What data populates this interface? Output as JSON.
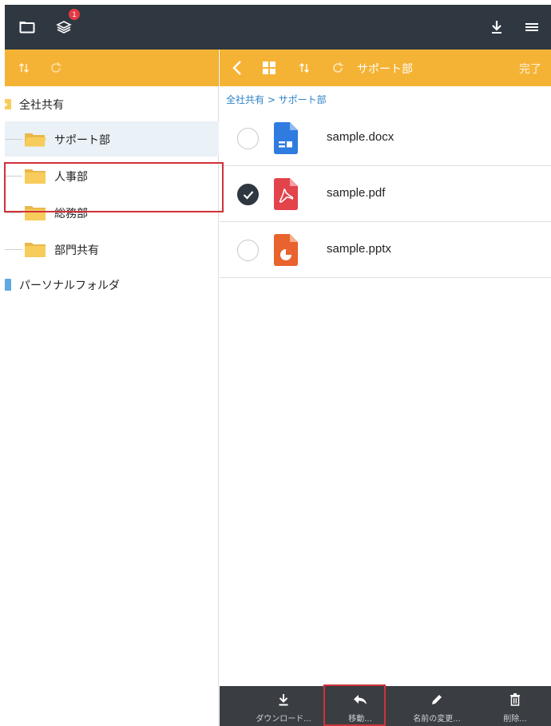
{
  "topbar": {
    "layers_badge": "1",
    "icons": [
      "folder-icon",
      "layers-icon",
      "download-icon",
      "menu-icon"
    ]
  },
  "left_toolbar": {
    "icons": [
      "sort-icon",
      "refresh-icon"
    ]
  },
  "right_toolbar": {
    "title": "サポート部",
    "done_label": "完了",
    "icons": [
      "back-chevron-icon",
      "grid-view-icon",
      "sort-icon",
      "refresh-icon"
    ]
  },
  "tree": {
    "root": "全社共有",
    "children": [
      {
        "label": "サポート部",
        "selected": true
      },
      {
        "label": "人事部",
        "selected": false
      },
      {
        "label": "総務部",
        "selected": false
      },
      {
        "label": "部門共有",
        "selected": false
      }
    ],
    "personal": "パーソナルフォルダ"
  },
  "content": {
    "breadcrumb": "全社共有 > サポート部",
    "files": [
      {
        "name": "sample.docx",
        "type": "docx",
        "checked": false
      },
      {
        "name": "sample.pdf",
        "type": "pdf",
        "checked": true
      },
      {
        "name": "sample.pptx",
        "type": "pptx",
        "checked": false
      }
    ]
  },
  "bottom_toolbar": {
    "download": "ダウンロード...",
    "move": "移動...",
    "rename": "名前の変更...",
    "delete": "削除..."
  },
  "colors": {
    "topbar": "#2f3740",
    "accent": "#f5b335",
    "docx": "#2f7be0",
    "pdf": "#e3434b",
    "pptx": "#e8632d",
    "folder": "#f7cc5a",
    "highlight": "#d0313a"
  }
}
